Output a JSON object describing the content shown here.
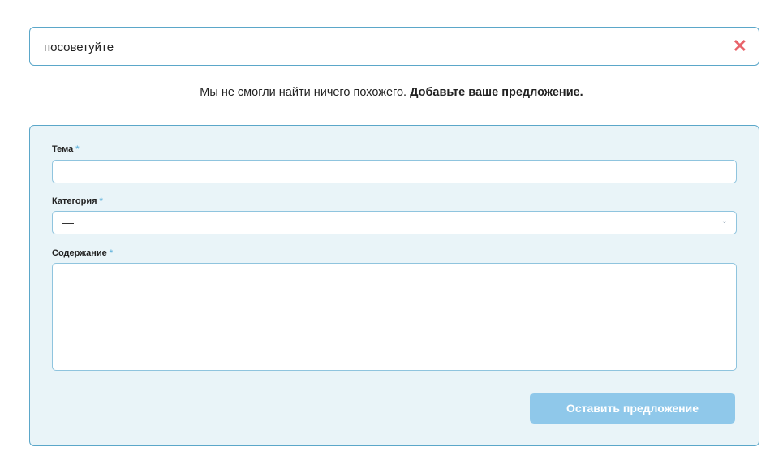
{
  "search": {
    "value": "посоветуйте",
    "clear_icon": "close-icon"
  },
  "message": {
    "text": "Мы не смогли найти ничего похожего.",
    "link": "Добавьте ваше предложение."
  },
  "form": {
    "topic_label": "Тема",
    "category_label": "Категория",
    "category_value": "—",
    "content_label": "Содержание",
    "required_mark": "*",
    "submit_label": "Оставить предложение"
  }
}
